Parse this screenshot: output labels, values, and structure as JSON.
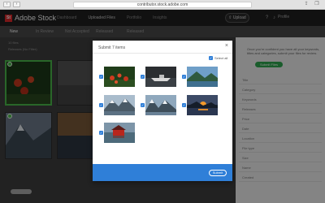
{
  "browser": {
    "url": "contributor.stock.adobe.com",
    "back_icon": "chevron-left",
    "forward_icon": "chevron-right"
  },
  "app": {
    "logo_text": "St",
    "brand": "Adobe Stock",
    "nav": [
      "Dashboard",
      "Uploaded Files",
      "Portfolio",
      "Insights"
    ],
    "upload_label": "Upload",
    "user": "Profile"
  },
  "subtabs": [
    "New",
    "In Review",
    "Not Accepted",
    "Released",
    "Released"
  ],
  "gallery": {
    "count_text": "10 files",
    "filter_text": "Releases (No Filter)"
  },
  "panel": {
    "intro": "Once you're confident you have all your keywords, titles and categories, submit your files for review.",
    "submit_files_label": "Submit Files",
    "rows": [
      "Title",
      "Category",
      "Keywords",
      "Releases",
      "Price",
      "Date",
      "Location",
      "File type",
      "Size",
      "Name",
      "Created"
    ]
  },
  "modal": {
    "title": "Submit 7 items",
    "close": "×",
    "select_all": "Select all",
    "submit_label": "Submit",
    "items": [
      {
        "name": "forest-poppies",
        "checked": true
      },
      {
        "name": "boat-on-lake",
        "checked": true
      },
      {
        "name": "mountain-lake",
        "checked": true
      },
      {
        "name": "snowy-mountains",
        "checked": true
      },
      {
        "name": "fjord-mountains",
        "checked": true
      },
      {
        "name": "sunset-lake",
        "checked": true
      },
      {
        "name": "red-cabin",
        "checked": true
      }
    ]
  },
  "colors": {
    "accent_blue": "#2f7fd8",
    "green": "#2fa84f",
    "adobe_red": "#e0282a"
  }
}
